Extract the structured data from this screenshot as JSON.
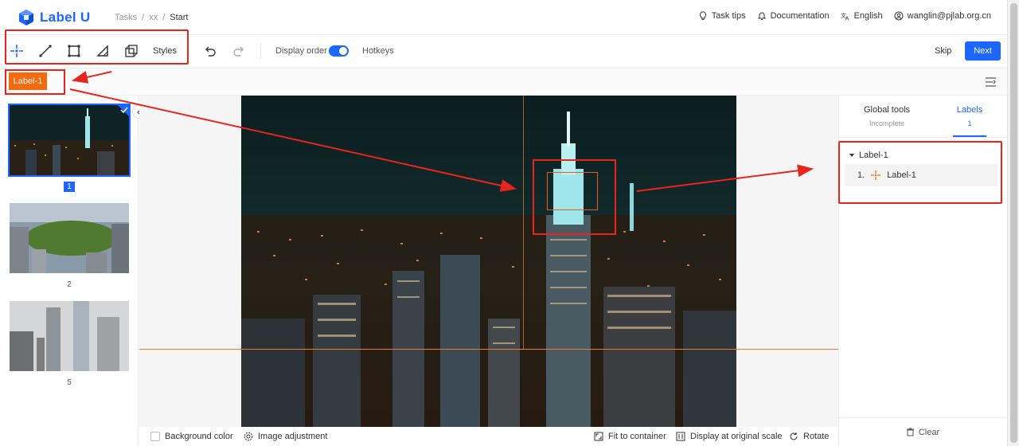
{
  "app": {
    "logo_text": "Label U",
    "brand_color": "#1b67ff",
    "accent_orange": "#f46a0c"
  },
  "breadcrumb": {
    "items": [
      "Tasks",
      "xx",
      "Start"
    ],
    "separator": "/"
  },
  "header": {
    "task_tips": "Task tips",
    "documentation": "Documentation",
    "language": "English",
    "user": "wanglin@pjlab.org.cn"
  },
  "toolbar": {
    "tools": [
      "point-tool",
      "line-tool",
      "rect-tool",
      "polygon-tool",
      "cuboid-tool"
    ],
    "styles_label": "Styles",
    "display_order_label": "Display order",
    "display_order_on": true,
    "hotkeys_label": "Hotkeys",
    "skip_label": "Skip",
    "next_label": "Next"
  },
  "labelbar": {
    "active_label": "Label-1"
  },
  "thumbnails": [
    {
      "num": "1",
      "selected": true
    },
    {
      "num": "2",
      "selected": false
    },
    {
      "num": "5",
      "selected": false
    }
  ],
  "bottom": {
    "background_color": "Background color",
    "image_adjustment": "Image adjustment",
    "fit_to_container": "Fit to container",
    "display_original": "Display at original scale",
    "rotate": "Rotate"
  },
  "right_panel": {
    "tab_global": "Global tools",
    "tab_global_sub": "Incomplete",
    "tab_labels": "Labels",
    "tab_labels_sub": "1",
    "group_name": "Label-1",
    "item_index": "1.",
    "item_name": "Label-1",
    "clear_label": "Clear"
  }
}
